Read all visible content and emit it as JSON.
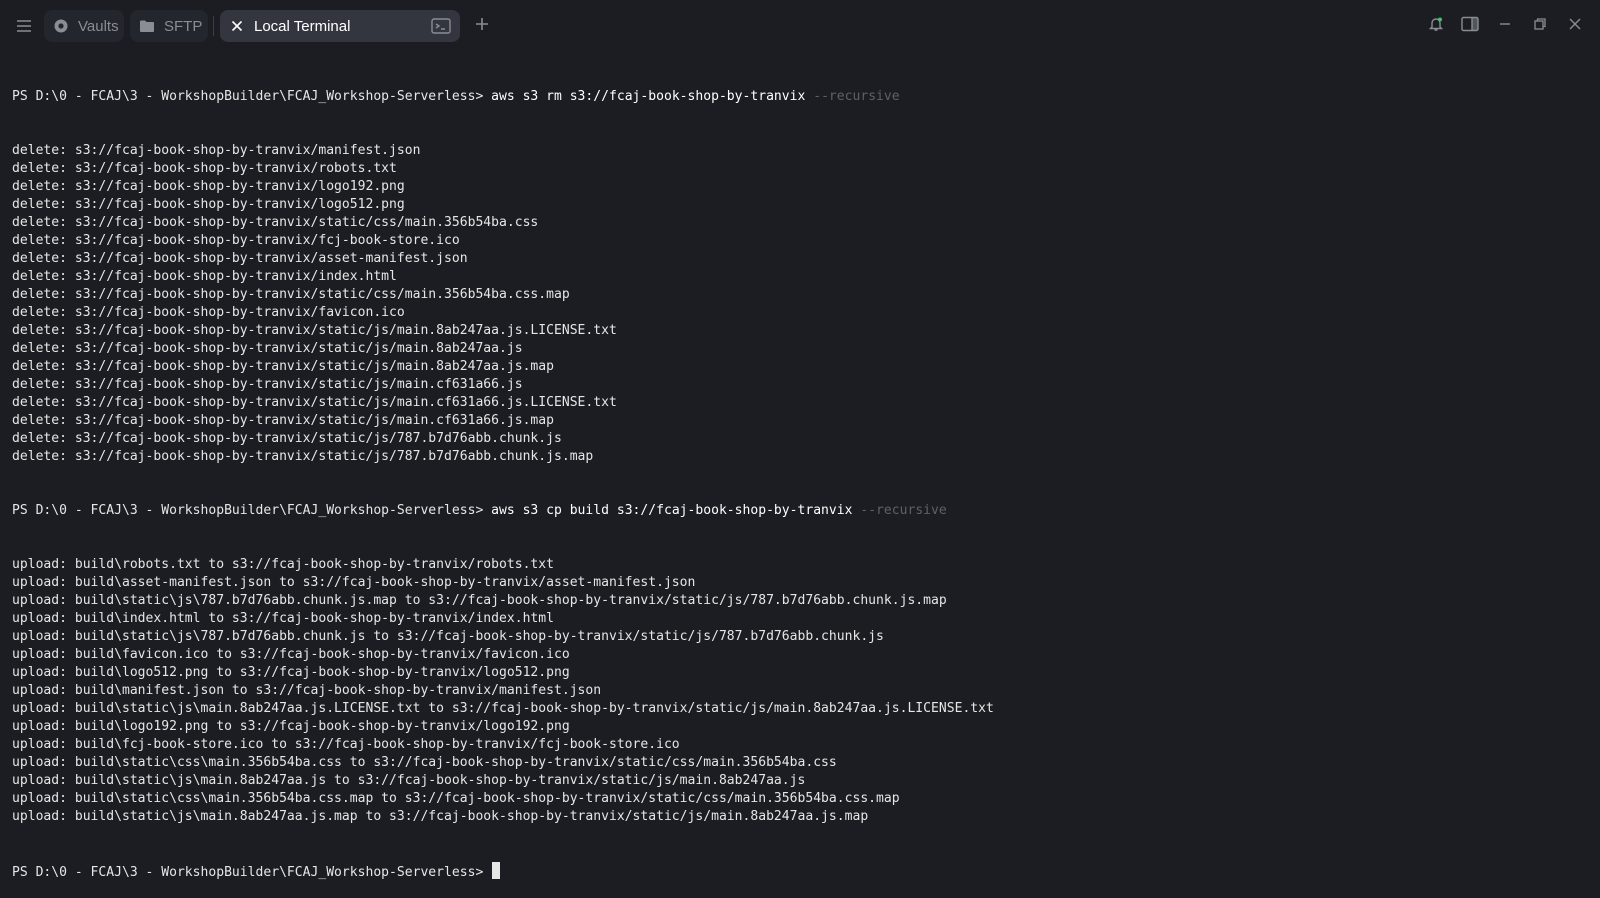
{
  "tabs": {
    "vaults_label": "Vaults",
    "sftp_label": "SFTP",
    "terminal_label": "Local Terminal"
  },
  "icons": {
    "menu": "hamburger-menu-icon",
    "vaults": "vault-icon",
    "sftp": "folder-icon",
    "close_tab": "close-icon",
    "terminal": "terminal-icon",
    "add": "plus-icon",
    "notifications": "bell-icon",
    "sidebar": "sidebar-toggle-icon",
    "minimize": "minimize-icon",
    "restore": "restore-icon",
    "close": "close-icon"
  },
  "colors": {
    "background": "#1b1d23",
    "active_tab": "#33363e",
    "inactive_tab": "#23262d",
    "text": "#e6e6e6",
    "dim_flag": "#5d6068"
  },
  "terminal": {
    "prompt": "PS D:\\0 - FCAJ\\3 - WorkshopBuilder\\FCAJ_Workshop-Serverless>",
    "commands": [
      {
        "cmd": "aws s3 rm s3://fcaj-book-shop-by-tranvix",
        "flag": "--recursive"
      },
      {
        "cmd": "aws s3 cp build s3://fcaj-book-shop-by-tranvix",
        "flag": "--recursive"
      }
    ],
    "delete_lines": [
      "delete: s3://fcaj-book-shop-by-tranvix/manifest.json",
      "delete: s3://fcaj-book-shop-by-tranvix/robots.txt",
      "delete: s3://fcaj-book-shop-by-tranvix/logo192.png",
      "delete: s3://fcaj-book-shop-by-tranvix/logo512.png",
      "delete: s3://fcaj-book-shop-by-tranvix/static/css/main.356b54ba.css",
      "delete: s3://fcaj-book-shop-by-tranvix/fcj-book-store.ico",
      "delete: s3://fcaj-book-shop-by-tranvix/asset-manifest.json",
      "delete: s3://fcaj-book-shop-by-tranvix/index.html",
      "delete: s3://fcaj-book-shop-by-tranvix/static/css/main.356b54ba.css.map",
      "delete: s3://fcaj-book-shop-by-tranvix/favicon.ico",
      "delete: s3://fcaj-book-shop-by-tranvix/static/js/main.8ab247aa.js.LICENSE.txt",
      "delete: s3://fcaj-book-shop-by-tranvix/static/js/main.8ab247aa.js",
      "delete: s3://fcaj-book-shop-by-tranvix/static/js/main.8ab247aa.js.map",
      "delete: s3://fcaj-book-shop-by-tranvix/static/js/main.cf631a66.js",
      "delete: s3://fcaj-book-shop-by-tranvix/static/js/main.cf631a66.js.LICENSE.txt",
      "delete: s3://fcaj-book-shop-by-tranvix/static/js/main.cf631a66.js.map",
      "delete: s3://fcaj-book-shop-by-tranvix/static/js/787.b7d76abb.chunk.js",
      "delete: s3://fcaj-book-shop-by-tranvix/static/js/787.b7d76abb.chunk.js.map"
    ],
    "upload_lines": [
      "upload: build\\robots.txt to s3://fcaj-book-shop-by-tranvix/robots.txt",
      "upload: build\\asset-manifest.json to s3://fcaj-book-shop-by-tranvix/asset-manifest.json",
      "upload: build\\static\\js\\787.b7d76abb.chunk.js.map to s3://fcaj-book-shop-by-tranvix/static/js/787.b7d76abb.chunk.js.map",
      "upload: build\\index.html to s3://fcaj-book-shop-by-tranvix/index.html",
      "upload: build\\static\\js\\787.b7d76abb.chunk.js to s3://fcaj-book-shop-by-tranvix/static/js/787.b7d76abb.chunk.js",
      "upload: build\\favicon.ico to s3://fcaj-book-shop-by-tranvix/favicon.ico",
      "upload: build\\logo512.png to s3://fcaj-book-shop-by-tranvix/logo512.png",
      "upload: build\\manifest.json to s3://fcaj-book-shop-by-tranvix/manifest.json",
      "upload: build\\static\\js\\main.8ab247aa.js.LICENSE.txt to s3://fcaj-book-shop-by-tranvix/static/js/main.8ab247aa.js.LICENSE.txt",
      "upload: build\\logo192.png to s3://fcaj-book-shop-by-tranvix/logo192.png",
      "upload: build\\fcj-book-store.ico to s3://fcaj-book-shop-by-tranvix/fcj-book-store.ico",
      "upload: build\\static\\css\\main.356b54ba.css to s3://fcaj-book-shop-by-tranvix/static/css/main.356b54ba.css",
      "upload: build\\static\\js\\main.8ab247aa.js to s3://fcaj-book-shop-by-tranvix/static/js/main.8ab247aa.js",
      "upload: build\\static\\css\\main.356b54ba.css.map to s3://fcaj-book-shop-by-tranvix/static/css/main.356b54ba.css.map",
      "upload: build\\static\\js\\main.8ab247aa.js.map to s3://fcaj-book-shop-by-tranvix/static/js/main.8ab247aa.js.map"
    ]
  }
}
